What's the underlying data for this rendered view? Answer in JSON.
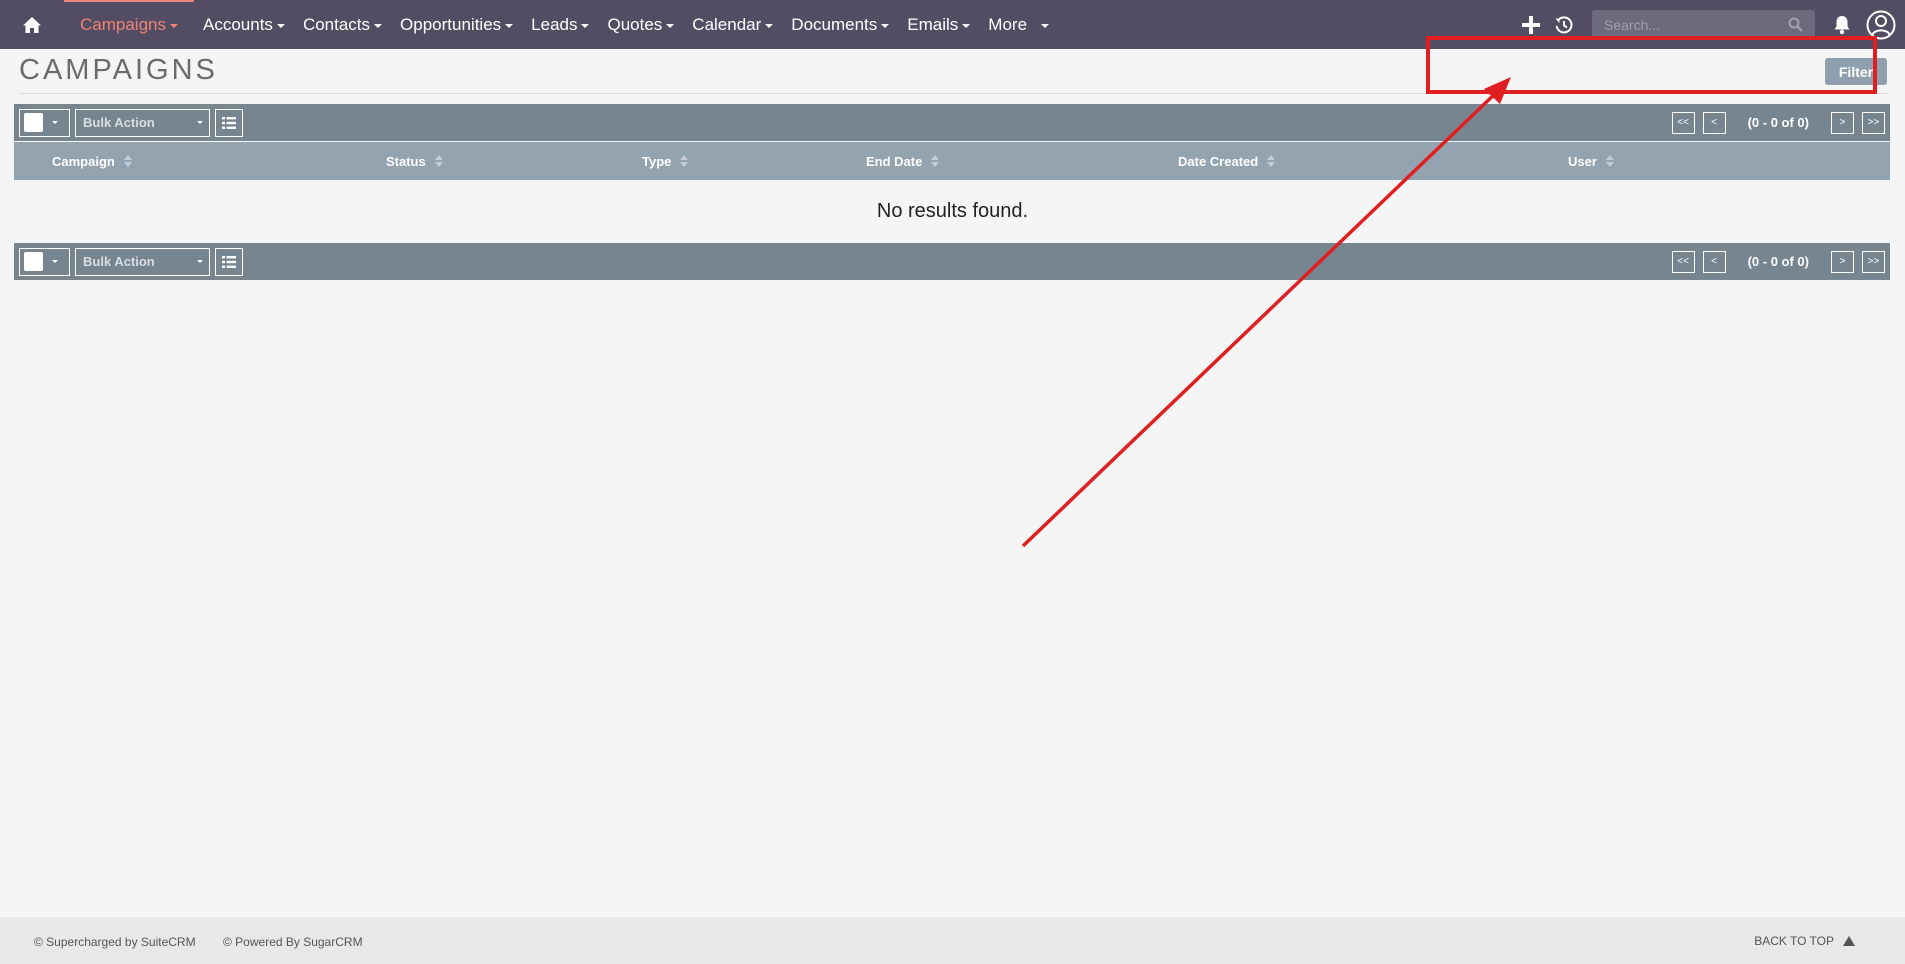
{
  "nav": {
    "items": [
      {
        "label": "Campaigns",
        "active": true
      },
      {
        "label": "Accounts"
      },
      {
        "label": "Contacts"
      },
      {
        "label": "Opportunities"
      },
      {
        "label": "Leads"
      },
      {
        "label": "Quotes"
      },
      {
        "label": "Calendar"
      },
      {
        "label": "Documents"
      },
      {
        "label": "Emails"
      },
      {
        "label": "More"
      }
    ],
    "search_placeholder": "Search...",
    "icons": [
      "home-icon",
      "plus-icon",
      "history-icon",
      "search-icon",
      "bell-icon",
      "user-icon"
    ]
  },
  "page": {
    "title": "CAMPAIGNS",
    "filter_label": "Filter"
  },
  "toolbar": {
    "bulk_action_label": "Bulk Action",
    "pager": {
      "first": "<<",
      "prev": "<",
      "count": "(0 - 0 of 0)",
      "next": ">",
      "last": ">>"
    }
  },
  "table": {
    "columns": [
      "Campaign",
      "Status",
      "Type",
      "End Date",
      "Date Created",
      "User"
    ],
    "empty_message": "No results found."
  },
  "footer": {
    "suitecrm": "© Supercharged by SuiteCRM",
    "sugarcrm": "© Powered By SugarCRM",
    "back_to_top": "BACK TO TOP"
  },
  "colors": {
    "nav_bg": "#534d64",
    "accent": "#f08377",
    "toolbar_bg": "#778591",
    "table_header_bg": "#94a3b0",
    "annotation": "#e02020"
  }
}
